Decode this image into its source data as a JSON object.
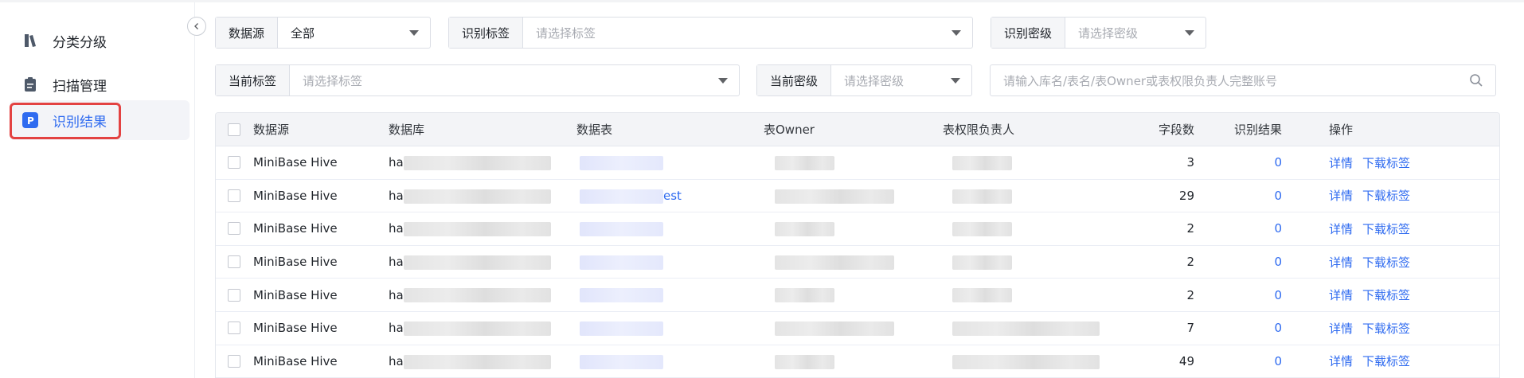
{
  "sidebar": {
    "items": [
      {
        "label": "分类分级",
        "icon": "classify-icon",
        "active": false
      },
      {
        "label": "扫描管理",
        "icon": "clipboard-icon",
        "active": false
      },
      {
        "label": "识别结果",
        "icon": "result-p-icon",
        "active": true
      }
    ]
  },
  "filters": {
    "datasource": {
      "label": "数据源",
      "value": "全部"
    },
    "recog_tag": {
      "label": "识别标签",
      "placeholder": "请选择标签"
    },
    "recog_level": {
      "label": "识别密级",
      "placeholder": "请选择密级"
    },
    "current_tag": {
      "label": "当前标签",
      "placeholder": "请选择标签"
    },
    "current_level": {
      "label": "当前密级",
      "placeholder": "请选择密级"
    },
    "search": {
      "placeholder": "请输入库名/表名/表Owner或表权限负责人完整账号"
    }
  },
  "table": {
    "headers": {
      "datasource": "数据源",
      "database": "数据库",
      "table": "数据表",
      "owner": "表Owner",
      "perm_owner": "表权限负责人",
      "field_count": "字段数",
      "result": "识别结果",
      "actions": "操作"
    },
    "rows": [
      {
        "datasource": "MiniBase Hive",
        "db_prefix": "ha",
        "table_suffix": "",
        "field_count": "3",
        "result": "0",
        "detail": "详情",
        "download": "下载标签"
      },
      {
        "datasource": "MiniBase Hive",
        "db_prefix": "ha",
        "table_suffix": "est",
        "field_count": "29",
        "result": "0",
        "detail": "详情",
        "download": "下载标签"
      },
      {
        "datasource": "MiniBase Hive",
        "db_prefix": "ha",
        "table_suffix": "",
        "field_count": "2",
        "result": "0",
        "detail": "详情",
        "download": "下载标签"
      },
      {
        "datasource": "MiniBase Hive",
        "db_prefix": "ha",
        "table_suffix": "",
        "field_count": "2",
        "result": "0",
        "detail": "详情",
        "download": "下载标签"
      },
      {
        "datasource": "MiniBase Hive",
        "db_prefix": "ha",
        "table_suffix": "",
        "field_count": "2",
        "result": "0",
        "detail": "详情",
        "download": "下载标签"
      },
      {
        "datasource": "MiniBase Hive",
        "db_prefix": "ha",
        "table_suffix": "",
        "field_count": "7",
        "result": "0",
        "detail": "详情",
        "download": "下载标签"
      },
      {
        "datasource": "MiniBase Hive",
        "db_prefix": "ha",
        "table_suffix": "",
        "field_count": "49",
        "result": "0",
        "detail": "详情",
        "download": "下载标签"
      }
    ]
  },
  "colors": {
    "accent": "#2f6bf0",
    "highlight": "#e34242"
  }
}
